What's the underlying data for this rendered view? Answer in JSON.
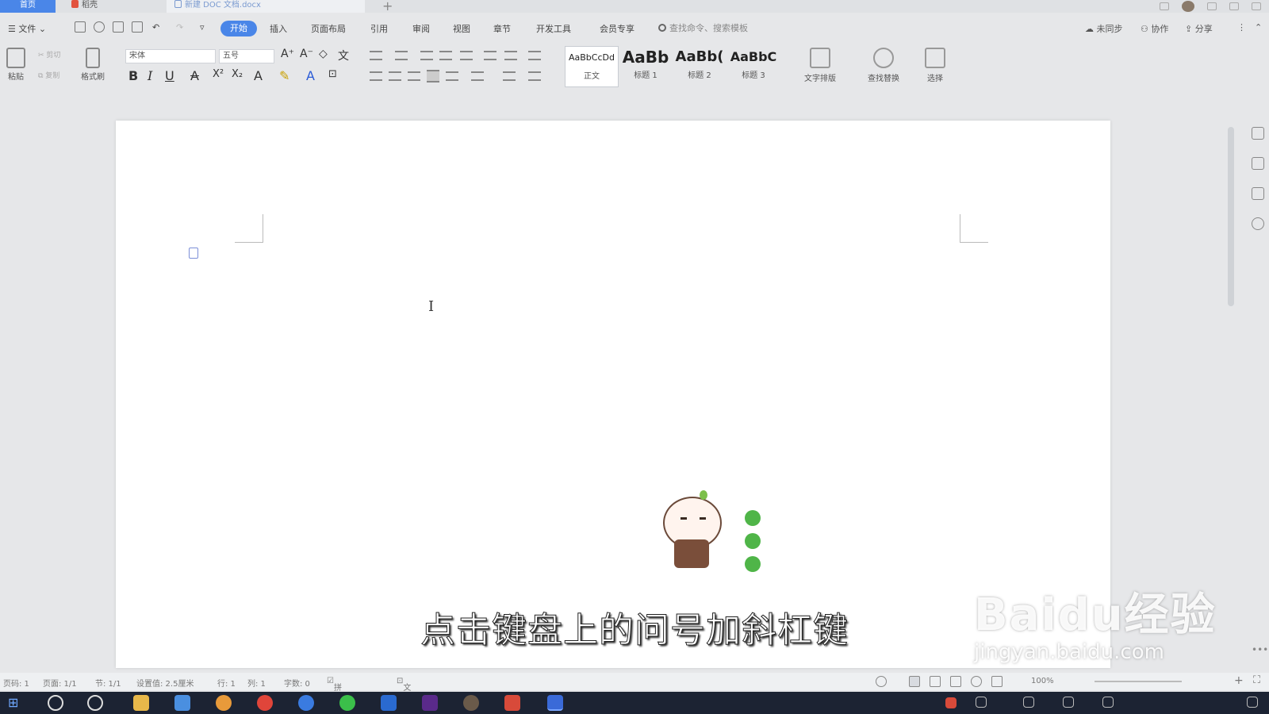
{
  "titlebar": {
    "home_tab": "首页",
    "tab1": "稻壳",
    "tab2": "新建 DOC 文档.docx"
  },
  "menu": {
    "file": "文件",
    "tabs": [
      "开始",
      "插入",
      "页面布局",
      "引用",
      "审阅",
      "视图",
      "章节",
      "开发工具",
      "会员专享"
    ],
    "search_placeholder": "查找命令、搜索模板",
    "sync": "未同步",
    "collab": "协作",
    "share": "分享"
  },
  "ribbon": {
    "paste": "粘贴",
    "cut": "剪切",
    "copy": "复制",
    "format_painter": "格式刷",
    "font_name": "宋体",
    "font_size": "五号",
    "styles": [
      {
        "preview": "AaBbCcDd",
        "name": "正文"
      },
      {
        "preview": "AaBb",
        "name": "标题 1"
      },
      {
        "preview": "AaBb(",
        "name": "标题 2"
      },
      {
        "preview": "AaBbC",
        "name": "标题 3"
      }
    ],
    "text_layout": "文字排版",
    "find_replace": "查找替换",
    "select": "选择"
  },
  "subtitle": "点击键盘上的问号加斜杠键",
  "watermark": {
    "brand": "Baidu经验",
    "url": "jingyan.baidu.com"
  },
  "status": {
    "page_num": "页码: 1",
    "pages": "页面: 1/1",
    "section": "节: 1/1",
    "setting": "设置值: 2.5厘米",
    "row": "行: 1",
    "col": "列: 1",
    "words": "字数: 0",
    "spell": "拼写检查",
    "proof": "文档校对",
    "zoom": "100%"
  }
}
